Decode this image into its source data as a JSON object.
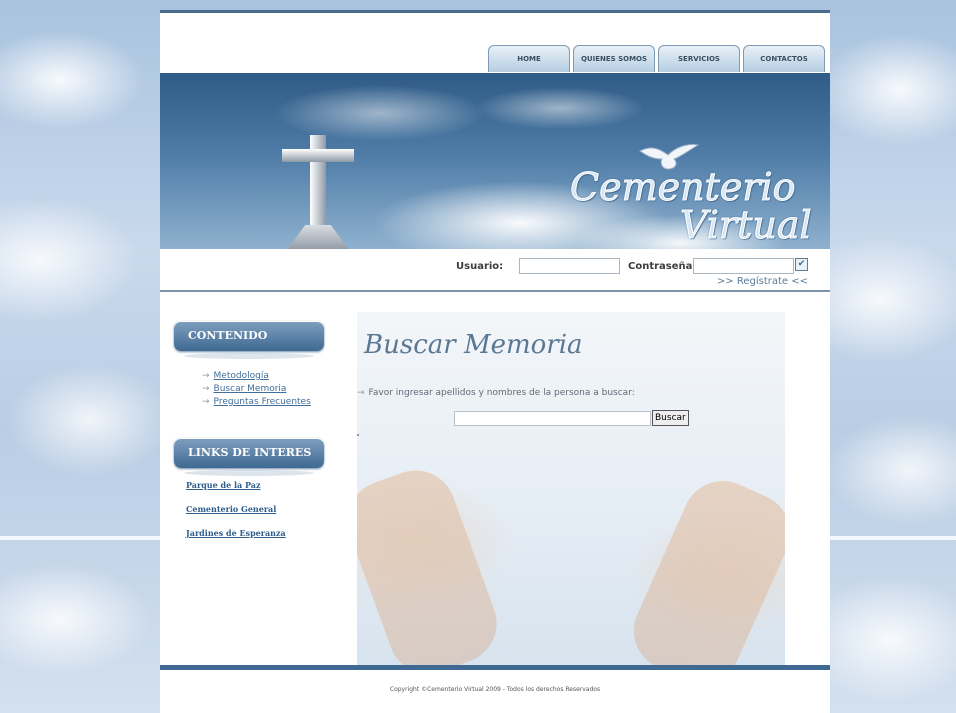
{
  "nav": {
    "items": [
      "HOME",
      "QUIENES SOMOS",
      "SERVICIOS",
      "CONTACTOS"
    ]
  },
  "banner": {
    "logo_line1": "Cementerio",
    "logo_line2": "Virtual"
  },
  "login": {
    "user_label": "Usuario:",
    "user_value": "",
    "pass_label": "Contraseña:",
    "pass_value": "",
    "submit_glyph": "✔",
    "register_link": ">> Regístrate <<"
  },
  "sidebar": {
    "content_heading": "CONTENIDO",
    "items": [
      "Metodología",
      "Buscar Memoria",
      "Preguntas Frecuentes"
    ],
    "links_heading": "LINKS DE INTERES",
    "links": [
      "Parque de la Paz",
      "Cementerio General",
      "Jardines de Esperanza"
    ]
  },
  "main": {
    "title": "Buscar Memoria",
    "instruction": "Favor ingresar apellidos y nombres de la persona a buscar:",
    "search_value": "",
    "search_button": "Buscar"
  },
  "footer": {
    "copyright": "Copyright ©Cementerio Virtual 2009 - Todos los derechos Reservados"
  },
  "colors": {
    "accent": "#3f6992",
    "link": "#3f6e9a",
    "nav_text": "#3a4e62"
  }
}
